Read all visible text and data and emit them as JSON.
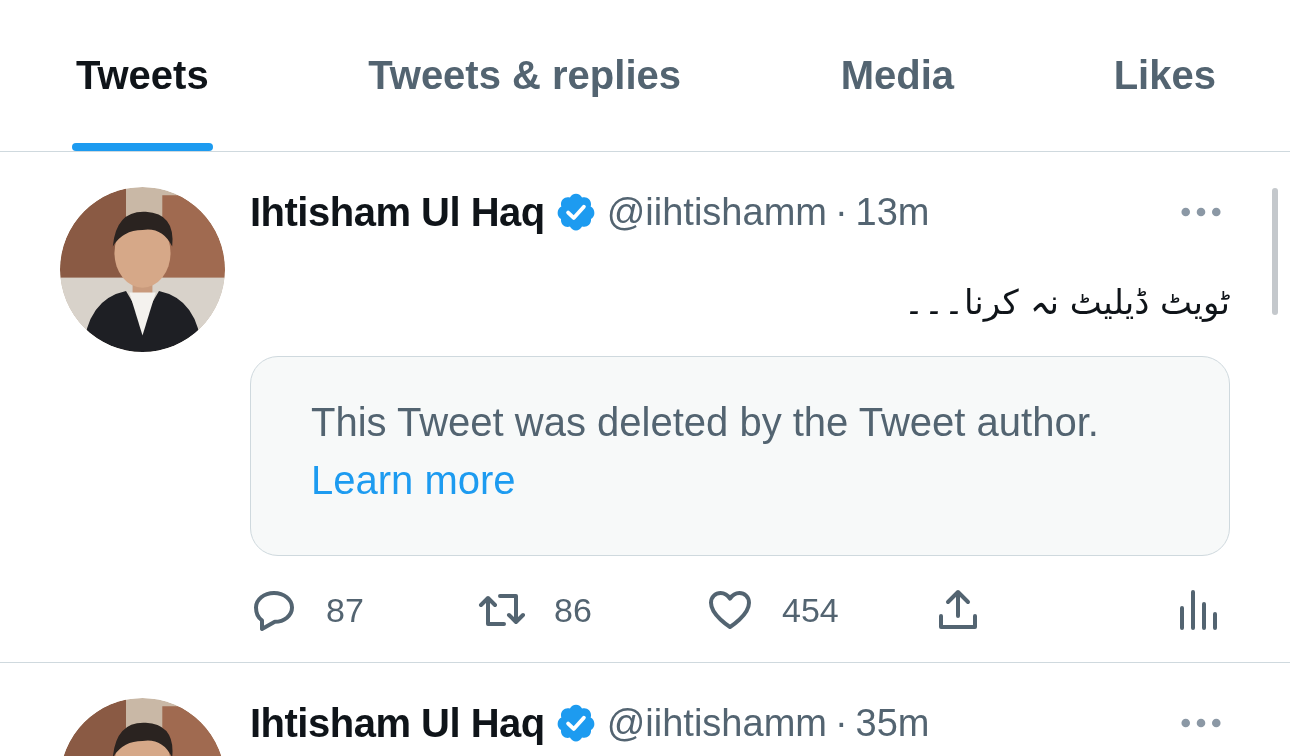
{
  "tabs": [
    {
      "label": "Tweets",
      "selected": true
    },
    {
      "label": "Tweets & replies",
      "selected": false
    },
    {
      "label": "Media",
      "selected": false
    },
    {
      "label": "Likes",
      "selected": false
    }
  ],
  "tweets": [
    {
      "name": "Ihtisham Ul Haq",
      "verified": true,
      "handle": "@iihtishamm",
      "dot": "·",
      "time": "13m",
      "text": "ٹویٹ ڈیلیٹ نہ کرنا۔۔۔",
      "notice": {
        "text": "This Tweet was deleted by the Tweet author.",
        "link": "Learn more"
      },
      "actions": [
        {
          "kind": "reply",
          "count": "87"
        },
        {
          "kind": "retweet",
          "count": "86"
        },
        {
          "kind": "like",
          "count": "454"
        },
        {
          "kind": "share"
        },
        {
          "kind": "views"
        }
      ]
    },
    {
      "name": "Ihtisham Ul Haq",
      "verified": true,
      "handle": "@iihtishamm",
      "dot": "·",
      "time": "35m"
    }
  ]
}
